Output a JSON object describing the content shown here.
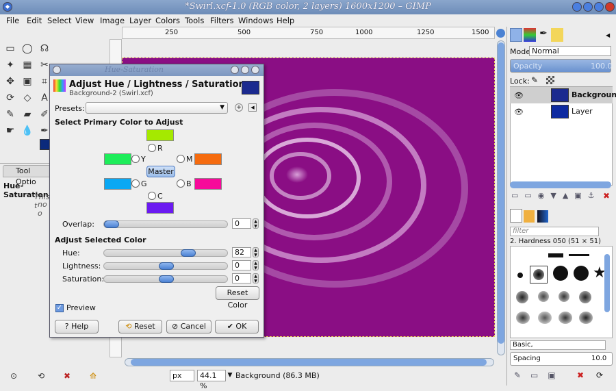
{
  "window": {
    "title": "*Swirl.xcf-1.0 (RGB color, 2 layers) 1600x1200 – GIMP"
  },
  "menubar": [
    "File",
    "Edit",
    "Select",
    "View",
    "Image",
    "Layer",
    "Colors",
    "Tools",
    "Filters",
    "Windows",
    "Help"
  ],
  "tool_options": {
    "tab": "Tool Optio",
    "title": "Hue-Saturation",
    "note1": "This t",
    "note2": "no o"
  },
  "ruler": {
    "ticks": [
      "250",
      "500",
      "750",
      "1000",
      "1250",
      "1500"
    ]
  },
  "status": {
    "unit": "px",
    "zoom": "44.1 %",
    "info": "Background (86.3 MB)"
  },
  "dialog": {
    "ghost_title": "Hue-Saturation",
    "title": "Adjust Hue / Lightness / Saturation",
    "subtitle": "Background-2 (Swirl.xcf)",
    "presets_label": "Presets:",
    "primary_heading": "Select Primary Color to Adjust",
    "colors": {
      "R": {
        "label": "R",
        "color": "#a5e900"
      },
      "Y": {
        "label": "Y",
        "color": "#1ded5a"
      },
      "G": {
        "label": "G",
        "color": "#0aa8f4"
      },
      "C": {
        "label": "C",
        "color": "#6b1af1"
      },
      "B": {
        "label": "B",
        "color": "#f70a9a"
      },
      "M": {
        "label": "M",
        "color": "#f56b0f"
      }
    },
    "master_label": "Master",
    "overlap": {
      "label": "Overlap:",
      "value": "0"
    },
    "adjust_heading": "Adjust Selected Color",
    "hue": {
      "label": "Hue:",
      "value": "82",
      "level": 0.7
    },
    "lightness": {
      "label": "Lightness:",
      "value": "0",
      "level": 0.5
    },
    "saturation": {
      "label": "Saturation:",
      "value": "0",
      "level": 0.5
    },
    "reset_color": "Reset Color",
    "preview": "Preview",
    "buttons": {
      "help": "Help",
      "reset": "Reset",
      "cancel": "Cancel",
      "ok": "OK"
    }
  },
  "layers": {
    "mode_label": "Mode:",
    "mode_value": "Normal",
    "opacity_label": "Opacity",
    "opacity_value": "100.0",
    "lock_label": "Lock:",
    "items": [
      "Background",
      "Layer"
    ]
  },
  "brushes": {
    "filter_placeholder": "filter",
    "current": "2. Hardness 050 (51 × 51)",
    "tag": "Basic,",
    "spacing_label": "Spacing",
    "spacing_value": "10.0"
  }
}
